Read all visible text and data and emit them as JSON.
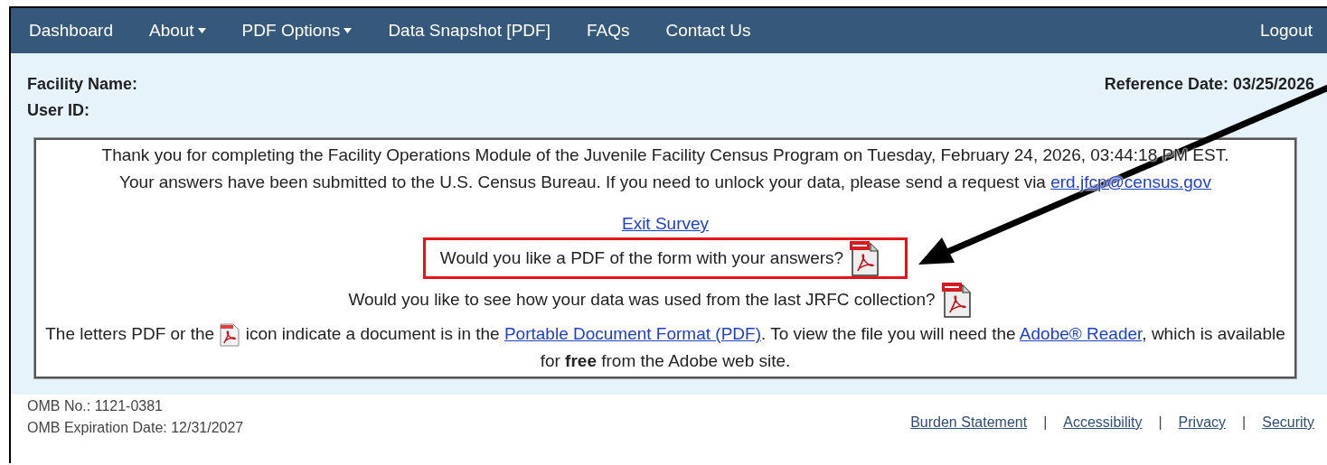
{
  "nav": {
    "items": [
      {
        "label": "Dashboard",
        "has_menu": false
      },
      {
        "label": "About",
        "has_menu": true
      },
      {
        "label": "PDF Options",
        "has_menu": true
      },
      {
        "label": "Data Snapshot [PDF]",
        "has_menu": false
      },
      {
        "label": "FAQs",
        "has_menu": false
      },
      {
        "label": "Contact Us",
        "has_menu": false
      }
    ],
    "logout": "Logout"
  },
  "header": {
    "facility_label": "Facility Name:",
    "user_id_label": "User ID:",
    "reference_date": "Reference Date: 03/25/2026"
  },
  "message": {
    "line_1": "Thank you for completing the Facility Operations Module of the Juvenile Facility Census Program on Tuesday, February 24, 2026, 03:44:18 PM EST.",
    "line_2": "Your answers have been submitted to the U.S. Census Bureau. If you need to unlock your data, please send a request via ",
    "email_link": "erd.jfcp@census.gov",
    "exit_link": "Exit Survey",
    "pdf_prompts": [
      {
        "text": "Would you like a PDF of the form with your answers?",
        "highlighted": true
      },
      {
        "text": "Would you like to see how your data was used from the last JRFC collection?",
        "highlighted": false
      }
    ],
    "notice": {
      "before_icon": "The letters PDF or the ",
      "after_icon": " icon indicate a document is in the ",
      "pdf_link": "Portable Document Format (PDF)",
      "middle": ". To view the file you will need the ",
      "reader_link": "Adobe® Reader",
      "end": ", which is available for **free** from the Adobe web site."
    }
  },
  "footer": {
    "omb_number": "OMB No.: 1121-0381",
    "omb_expiration": "OMB Expiration Date: 12/31/2027",
    "links": [
      "Burden Statement",
      "Accessibility",
      "Privacy",
      "Security"
    ],
    "separator": "|"
  }
}
